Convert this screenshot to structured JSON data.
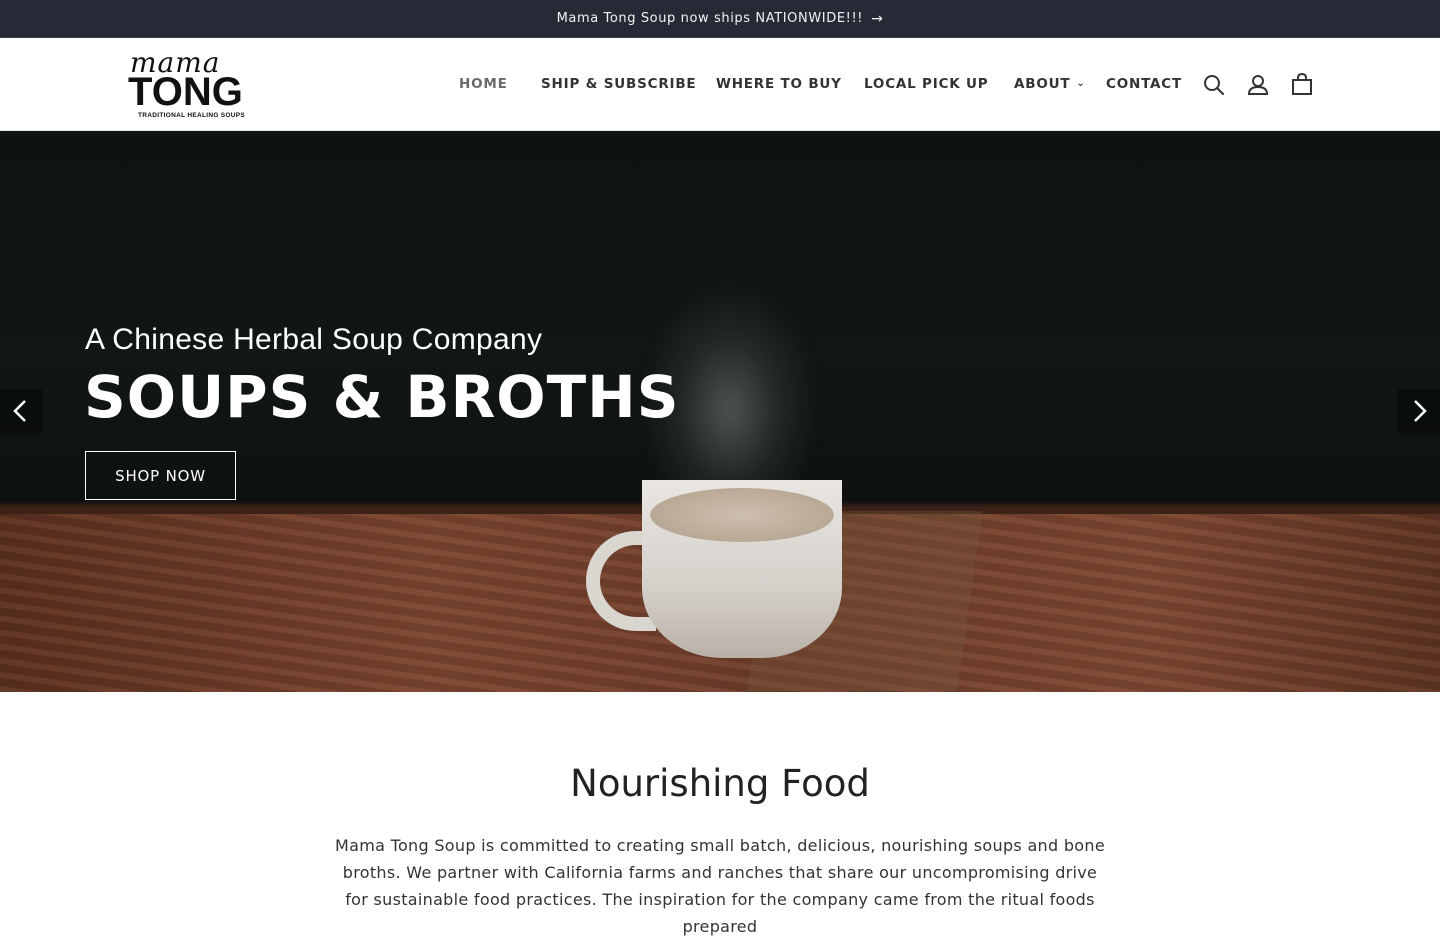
{
  "announcement": {
    "text": "Mama Tong Soup now ships NATIONWIDE!!!",
    "arrow_icon": "arrow-right-icon"
  },
  "logo": {
    "script_text": "mama",
    "word_text": "TONG",
    "tagline": "TRADITIONAL HEALING SOUPS"
  },
  "nav": {
    "items": [
      {
        "label": "HOME",
        "active": true
      },
      {
        "label": "SHIP & SUBSCRIBE"
      },
      {
        "label": "WHERE TO BUY"
      },
      {
        "label": "LOCAL PICK UP"
      },
      {
        "label": "ABOUT",
        "has_dropdown": true
      },
      {
        "label": "CONTACT"
      }
    ],
    "icons": [
      "search-icon",
      "account-icon",
      "cart-icon"
    ]
  },
  "hero": {
    "kicker": "A Chinese Herbal Soup Company",
    "headline": "SOUPS & BROTHS",
    "cta_label": "SHOP NOW"
  },
  "intro": {
    "title": "Nourishing Food",
    "body": "Mama Tong Soup is committed to creating small batch, delicious, nourishing soups and bone broths. We partner with California farms and ranches that share our uncompromising drive for sustainable food practices. The inspiration for the company came from the ritual foods prepared"
  },
  "colors": {
    "announcement_bg": "#262a36",
    "text_dark": "#333333",
    "white": "#ffffff"
  }
}
